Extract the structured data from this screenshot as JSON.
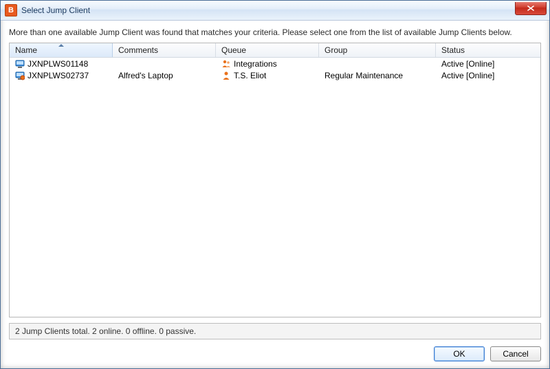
{
  "window": {
    "title": "Select Jump Client",
    "appIconLetter": "B"
  },
  "instruction": "More than one available Jump Client was found that matches your criteria. Please select one from the list of available Jump Clients below.",
  "columns": {
    "name": "Name",
    "comments": "Comments",
    "queue": "Queue",
    "group": "Group",
    "status": "Status"
  },
  "rows": [
    {
      "name": "JXNPLWS01148",
      "comments": "",
      "queue": "Integrations",
      "group": "",
      "status": "Active [Online]",
      "iconKind": "monitor"
    },
    {
      "name": "JXNPLWS02737",
      "comments": "Alfred's Laptop",
      "queue": "T.S. Eliot",
      "group": "Regular Maintenance",
      "status": "Active [Online]",
      "iconKind": "monitor-badge"
    }
  ],
  "statusText": "2 Jump Clients total.  2 online.  0 offline.  0 passive.",
  "buttons": {
    "ok": "OK",
    "cancel": "Cancel"
  }
}
